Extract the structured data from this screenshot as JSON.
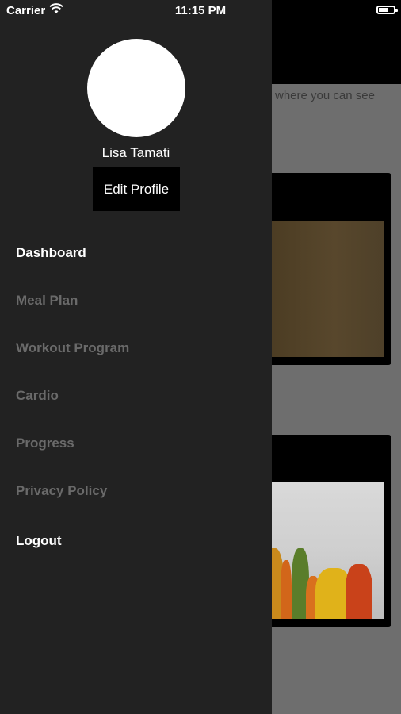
{
  "status_bar": {
    "carrier": "Carrier",
    "time": "11:15 PM",
    "wifi_icon": "wifi-icon",
    "battery_icon": "battery-icon"
  },
  "profile": {
    "name": "Lisa Tamati",
    "edit_label": "Edit Profile"
  },
  "menu": {
    "items": [
      {
        "label": "Dashboard",
        "state": "active"
      },
      {
        "label": "Meal Plan",
        "state": "inactive"
      },
      {
        "label": "Workout Program",
        "state": "inactive"
      },
      {
        "label": "Cardio",
        "state": "inactive"
      },
      {
        "label": "Progress",
        "state": "inactive"
      },
      {
        "label": "Privacy Policy",
        "state": "inactive"
      },
      {
        "label": "Logout",
        "state": "action"
      }
    ]
  },
  "background": {
    "intro_text": "where you can see"
  },
  "colors": {
    "drawer_bg": "#222222",
    "active_text": "#ffffff",
    "inactive_text": "#6a6a6a",
    "button_bg": "#000000"
  }
}
